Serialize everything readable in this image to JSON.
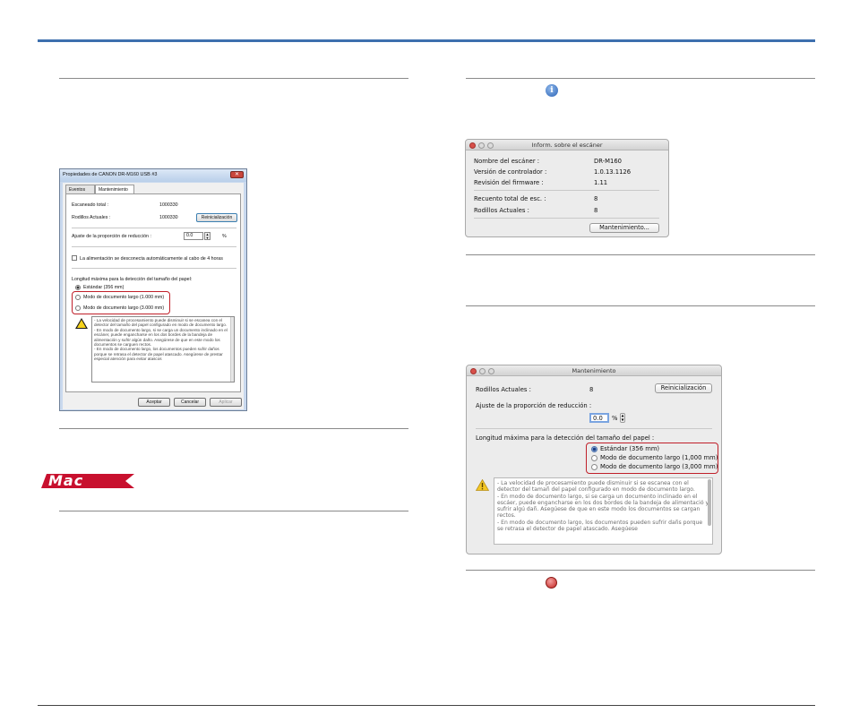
{
  "win_dialog": {
    "title": "Propiedades de CANON DR-M160 USB #3",
    "close_glyph": "✕",
    "tabs": [
      "Eventos",
      "Mantenimiento"
    ],
    "scanned_total_label": "Escaneado total :",
    "scanned_total_value": "1000330",
    "rollers_label": "Rodillos Actuales :",
    "rollers_value": "1000330",
    "reset_button": "Reinicialización",
    "ratio_label": "Ajuste de la proporción de reducción :",
    "ratio_value": "0.0",
    "ratio_unit": "%",
    "auto_off_label": "La alimentación se desconecta automáticamente al cabo de 4 horas",
    "max_length_label": "Longitud máxima para la detección del tamaño del papel:",
    "radio_standard": "Estándar (356 mm)",
    "radio_long1": "Modo de documento largo (1.000 mm)",
    "radio_long3": "Modo de documento largo (3.000 mm)",
    "warning_text": "- La velocidad de procesamiento puede disminuir si se escanea con el detector del tamaño del papel configurado en modo de documento largo.\n- En modo de documento largo, si se carga un documento inclinado en el escáner, puede engancharse en los dos bordes de la bandeja de alimentación y sufrir algún daño. Asegúrese de que en este modo los documentos se carguen rectos.\n- En modo de documento largo, los documentos pueden sufrir daños porque se retrasa el detector de papel atascado. Asegúrese de prestar especial atención para evitar atascos",
    "ok_button": "Aceptar",
    "cancel_button": "Cancelar",
    "apply_button": "Aplicar"
  },
  "mac_logo_text": "Mac",
  "mac_info_window": {
    "title": "Inform. sobre el escáner",
    "rows": [
      {
        "label": "Nombre del escáner :",
        "value": "DR-M160"
      },
      {
        "label": "Versión de controlador :",
        "value": "1.0.13.1126"
      },
      {
        "label": "Revisión del firmware :",
        "value": "1.11"
      },
      {
        "label": "Recuento total de esc. :",
        "value": "8"
      },
      {
        "label": "Rodillos Actuales :",
        "value": "8"
      }
    ],
    "maintenance_button": "Mantenimiento..."
  },
  "mac_maint_window": {
    "title": "Mantenimiento",
    "rollers_label": "Rodillos Actuales :",
    "rollers_value": "8",
    "reset_button": "Reinicialización",
    "ratio_label": "Ajuste de la proporción de reducción :",
    "ratio_value": "0.0",
    "ratio_unit": "%",
    "max_length_label": "Longitud máxima para la detección del tamaño del papel :",
    "radio_standard": "Estándar (356 mm)",
    "radio_long1": "Modo de documento largo (1,000 mm)",
    "radio_long3": "Modo de documento largo (3,000 mm)",
    "warning_text": "- La velocidad de procesamiento puede disminuir si se escanea con el detector del tamañ del papel configurado en modo de documento largo.\n- En modo de documento largo, si se carga un documento inclinado en el escáer, puede engancharse en los dos bordes de la bandeja de alimentació y sufrir algú dañ. Asegúese de que en este modo los documentos se cargan rectos.\n- En modo de documento largo, los documentos pueden sufrir dañs porque se retrasa el detector de papel atascado. Asegúese"
  },
  "colors": {
    "top_bar": "#3d6fae",
    "highlight": "#c0202a",
    "mac_logo": "#c8102e"
  },
  "icons": {
    "info": "info-icon",
    "close": "red-close-button-icon",
    "warning": "warning-icon"
  }
}
